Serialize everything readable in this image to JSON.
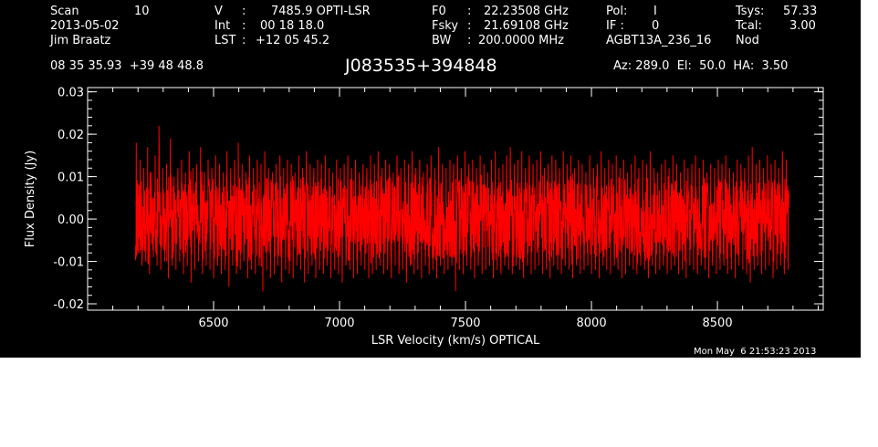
{
  "header": {
    "col1": {
      "scan_label": "Scan",
      "scan_value": "10",
      "date": "2013-05-02",
      "observer": "Jim Braatz"
    },
    "col2": {
      "v_label": "V",
      "v_sep": ":",
      "v_value": "7485.9 OPTI-LSR",
      "int_label": "Int",
      "int_sep": ":",
      "int_value": "00 18 18.0",
      "lst_label": "LST",
      "lst_sep": ":",
      "lst_value": "+12 05 45.2"
    },
    "col3": {
      "f0_label": "F0",
      "f0_sep": ":",
      "f0_value": "22.23508 GHz",
      "fsky_label": "Fsky",
      "fsky_sep": ":",
      "fsky_value": "21.69108 GHz",
      "bw_label": "BW",
      "bw_sep": ":",
      "bw_value": "200.0000 MHz"
    },
    "col4": {
      "pol_label": "Pol:",
      "pol_value": "I",
      "if_label": "IF :",
      "if_value": "0",
      "project": "AGBT13A_236_16"
    },
    "col5": {
      "tsys_label": "Tsys:",
      "tsys_value": "57.33",
      "tcal_label": "Tcal:",
      "tcal_value": "3.00",
      "mode": "Nod"
    },
    "coords": "08 35 35.93  +39 48 48.8",
    "source": "J083535+394848",
    "pointing": "Az: 289.0  El:  50.0  HA:  3.50"
  },
  "timestamp": "Mon May  6 21:53:23 2013",
  "colors": {
    "background": "#000000",
    "foreground": "#ffffff",
    "trace": "#ff0000"
  },
  "chart_data": {
    "type": "line",
    "title": "J083535+394848",
    "xlabel": "LSR Velocity (km/s) OPTICAL",
    "ylabel": "Flux Density (Jy)",
    "xlim": [
      6000,
      8920
    ],
    "ylim": [
      -0.0215,
      0.031
    ],
    "x_ticks": [
      6500,
      7000,
      7500,
      8000,
      8500
    ],
    "x_tick_labels": [
      "6500",
      "7000",
      "7500",
      "8000",
      "8500"
    ],
    "y_ticks": [
      -0.02,
      -0.01,
      0.0,
      0.01,
      0.02,
      0.03
    ],
    "y_tick_labels": [
      "-0.02",
      "-0.01",
      "0.00",
      "0.01",
      "0.02",
      "0.03"
    ],
    "grid": false,
    "legend": "none",
    "series": [
      {
        "color": "#ff0000",
        "x": [
          6190,
          6205,
          6220,
          6235,
          6250,
          6265,
          6280,
          6295,
          6310,
          6325,
          6340,
          6355,
          6370,
          6385,
          6400,
          6415,
          6430,
          6445,
          6460,
          6475,
          6490,
          6505,
          6520,
          6535,
          6550,
          6565,
          6580,
          6595,
          6610,
          6625,
          6640,
          6655,
          6670,
          6685,
          6700,
          6715,
          6730,
          6745,
          6760,
          6775,
          6790,
          6805,
          6820,
          6835,
          6850,
          6865,
          6880,
          6895,
          6910,
          6925,
          6940,
          6955,
          6970,
          6985,
          7000,
          7015,
          7030,
          7045,
          7060,
          7075,
          7090,
          7105,
          7120,
          7135,
          7150,
          7165,
          7180,
          7195,
          7210,
          7225,
          7240,
          7255,
          7270,
          7285,
          7300,
          7315,
          7330,
          7345,
          7360,
          7375,
          7390,
          7405,
          7420,
          7435,
          7450,
          7465,
          7480,
          7495,
          7510,
          7525,
          7540,
          7555,
          7570,
          7585,
          7600,
          7615,
          7630,
          7645,
          7660,
          7675,
          7690,
          7705,
          7720,
          7735,
          7750,
          7765,
          7780,
          7795,
          7810,
          7825,
          7840,
          7855,
          7870,
          7885,
          7900,
          7915,
          7930,
          7945,
          7960,
          7975,
          7990,
          8005,
          8020,
          8035,
          8050,
          8065,
          8080,
          8095,
          8110,
          8125,
          8140,
          8155,
          8170,
          8185,
          8200,
          8215,
          8230,
          8245,
          8260,
          8275,
          8290,
          8305,
          8320,
          8335,
          8350,
          8365,
          8380,
          8395,
          8410,
          8425,
          8440,
          8455,
          8470,
          8485,
          8500,
          8515,
          8530,
          8545,
          8560,
          8575,
          8590,
          8605,
          8620,
          8635,
          8650,
          8665,
          8680,
          8695,
          8710,
          8725,
          8740,
          8755,
          8770,
          8785,
          8800
        ],
        "y_max": [
          0.018,
          0.014,
          0.012,
          0.017,
          0.011,
          0.015,
          0.022,
          0.012,
          0.013,
          0.019,
          0.01,
          0.012,
          0.014,
          0.011,
          0.016,
          0.012,
          0.013,
          0.017,
          0.011,
          0.014,
          0.012,
          0.015,
          0.013,
          0.011,
          0.016,
          0.012,
          0.014,
          0.018,
          0.013,
          0.011,
          0.015,
          0.012,
          0.014,
          0.013,
          0.016,
          0.012,
          0.011,
          0.013,
          0.015,
          0.012,
          0.014,
          0.013,
          0.011,
          0.015,
          0.012,
          0.016,
          0.013,
          0.012,
          0.014,
          0.013,
          0.015,
          0.012,
          0.011,
          0.014,
          0.012,
          0.013,
          0.015,
          0.012,
          0.014,
          0.011,
          0.013,
          0.012,
          0.015,
          0.013,
          0.016,
          0.012,
          0.014,
          0.013,
          0.011,
          0.015,
          0.012,
          0.014,
          0.013,
          0.016,
          0.012,
          0.014,
          0.011,
          0.013,
          0.015,
          0.012,
          0.017,
          0.013,
          0.012,
          0.014,
          0.013,
          0.015,
          0.012,
          0.016,
          0.013,
          0.014,
          0.012,
          0.015,
          0.013,
          0.011,
          0.014,
          0.016,
          0.012,
          0.013,
          0.015,
          0.017,
          0.013,
          0.014,
          0.016,
          0.012,
          0.015,
          0.013,
          0.014,
          0.016,
          0.012,
          0.013,
          0.015,
          0.014,
          0.012,
          0.016,
          0.013,
          0.015,
          0.012,
          0.014,
          0.013,
          0.011,
          0.015,
          0.012,
          0.013,
          0.016,
          0.012,
          0.014,
          0.013,
          0.015,
          0.012,
          0.014,
          0.011,
          0.013,
          0.015,
          0.012,
          0.014,
          0.013,
          0.016,
          0.012,
          0.011,
          0.013,
          0.014,
          0.012,
          0.015,
          0.013,
          0.011,
          0.014,
          0.012,
          0.013,
          0.015,
          0.012,
          0.014,
          0.011,
          0.013,
          0.012,
          0.014,
          0.013,
          0.015,
          0.012,
          0.011,
          0.014,
          0.013,
          0.012,
          0.015,
          0.017,
          0.013,
          0.014,
          0.012,
          0.015,
          0.013,
          0.014,
          0.012,
          0.016,
          0.014,
          0.012,
          0.015
        ],
        "y_min": [
          -0.008,
          -0.011,
          -0.01,
          -0.013,
          -0.009,
          -0.011,
          -0.012,
          -0.01,
          -0.014,
          -0.011,
          -0.012,
          -0.01,
          -0.013,
          -0.011,
          -0.015,
          -0.012,
          -0.01,
          -0.013,
          -0.011,
          -0.012,
          -0.014,
          -0.011,
          -0.013,
          -0.012,
          -0.016,
          -0.011,
          -0.013,
          -0.012,
          -0.01,
          -0.014,
          -0.012,
          -0.013,
          -0.011,
          -0.017,
          -0.012,
          -0.014,
          -0.013,
          -0.011,
          -0.015,
          -0.012,
          -0.013,
          -0.014,
          -0.011,
          -0.012,
          -0.015,
          -0.013,
          -0.011,
          -0.014,
          -0.012,
          -0.013,
          -0.011,
          -0.014,
          -0.012,
          -0.013,
          -0.015,
          -0.011,
          -0.012,
          -0.014,
          -0.013,
          -0.011,
          -0.012,
          -0.014,
          -0.013,
          -0.012,
          -0.011,
          -0.013,
          -0.012,
          -0.014,
          -0.011,
          -0.013,
          -0.012,
          -0.015,
          -0.011,
          -0.013,
          -0.012,
          -0.014,
          -0.011,
          -0.013,
          -0.012,
          -0.014,
          -0.011,
          -0.013,
          -0.012,
          -0.011,
          -0.017,
          -0.012,
          -0.013,
          -0.011,
          -0.012,
          -0.014,
          -0.011,
          -0.013,
          -0.012,
          -0.011,
          -0.014,
          -0.012,
          -0.013,
          -0.011,
          -0.012,
          -0.013,
          -0.011,
          -0.012,
          -0.014,
          -0.011,
          -0.013,
          -0.012,
          -0.011,
          -0.013,
          -0.012,
          -0.014,
          -0.011,
          -0.012,
          -0.013,
          -0.011,
          -0.012,
          -0.014,
          -0.011,
          -0.013,
          -0.012,
          -0.011,
          -0.013,
          -0.012,
          -0.014,
          -0.011,
          -0.012,
          -0.013,
          -0.011,
          -0.012,
          -0.014,
          -0.013,
          -0.011,
          -0.012,
          -0.013,
          -0.011,
          -0.012,
          -0.014,
          -0.011,
          -0.013,
          -0.012,
          -0.011,
          -0.013,
          -0.012,
          -0.011,
          -0.013,
          -0.012,
          -0.014,
          -0.011,
          -0.012,
          -0.013,
          -0.011,
          -0.012,
          -0.014,
          -0.011,
          -0.013,
          -0.012,
          -0.011,
          -0.013,
          -0.012,
          -0.014,
          -0.011,
          -0.012,
          -0.013,
          -0.015,
          -0.012,
          -0.011,
          -0.013,
          -0.012,
          -0.011,
          -0.014,
          -0.012,
          -0.011,
          -0.013,
          -0.012
        ]
      }
    ]
  }
}
